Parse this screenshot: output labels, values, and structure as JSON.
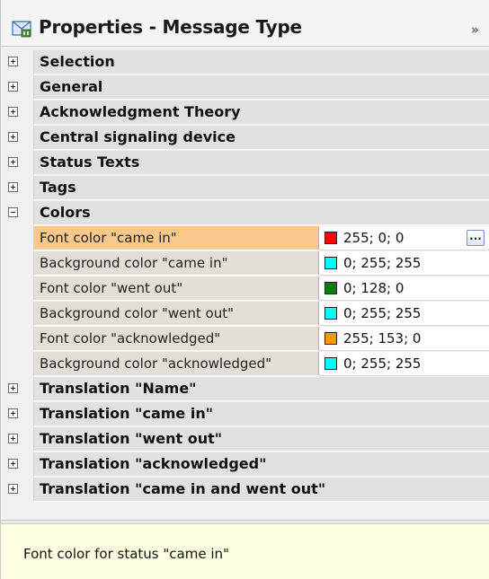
{
  "title": "Properties - Message Type",
  "title_icon": "message-type-icon",
  "collapse_glyph": "»",
  "categories_top": [
    {
      "label": "Selection",
      "expanded": false
    },
    {
      "label": "General",
      "expanded": false
    },
    {
      "label": "Acknowledgment Theory",
      "expanded": false
    },
    {
      "label": "Central signaling device",
      "expanded": false
    },
    {
      "label": "Status Texts",
      "expanded": false
    },
    {
      "label": "Tags",
      "expanded": false
    },
    {
      "label": "Colors",
      "expanded": true
    }
  ],
  "colors": [
    {
      "name": "Font color \"came in\"",
      "value": "255; 0; 0",
      "swatch": "#ff0000",
      "selected": true
    },
    {
      "name": "Background color \"came in\"",
      "value": "0; 255; 255",
      "swatch": "#00ffff",
      "selected": false
    },
    {
      "name": "Font color \"went out\"",
      "value": "0; 128; 0",
      "swatch": "#008000",
      "selected": false
    },
    {
      "name": "Background color \"went out\"",
      "value": "0; 255; 255",
      "swatch": "#00ffff",
      "selected": false
    },
    {
      "name": "Font color \"acknowledged\"",
      "value": "255; 153; 0",
      "swatch": "#ff9900",
      "selected": false
    },
    {
      "name": "Background color \"acknowledged\"",
      "value": "0; 255; 255",
      "swatch": "#00ffff",
      "selected": false
    }
  ],
  "ellipsis_label": "...",
  "categories_bottom": [
    {
      "label": "Translation \"Name\"",
      "expanded": false
    },
    {
      "label": "Translation \"came in\"",
      "expanded": false
    },
    {
      "label": "Translation \"went out\"",
      "expanded": false
    },
    {
      "label": "Translation \"acknowledged\"",
      "expanded": false
    },
    {
      "label": "Translation \"came in and went out\"",
      "expanded": false
    }
  ],
  "description": "Font color for status \"came in\""
}
